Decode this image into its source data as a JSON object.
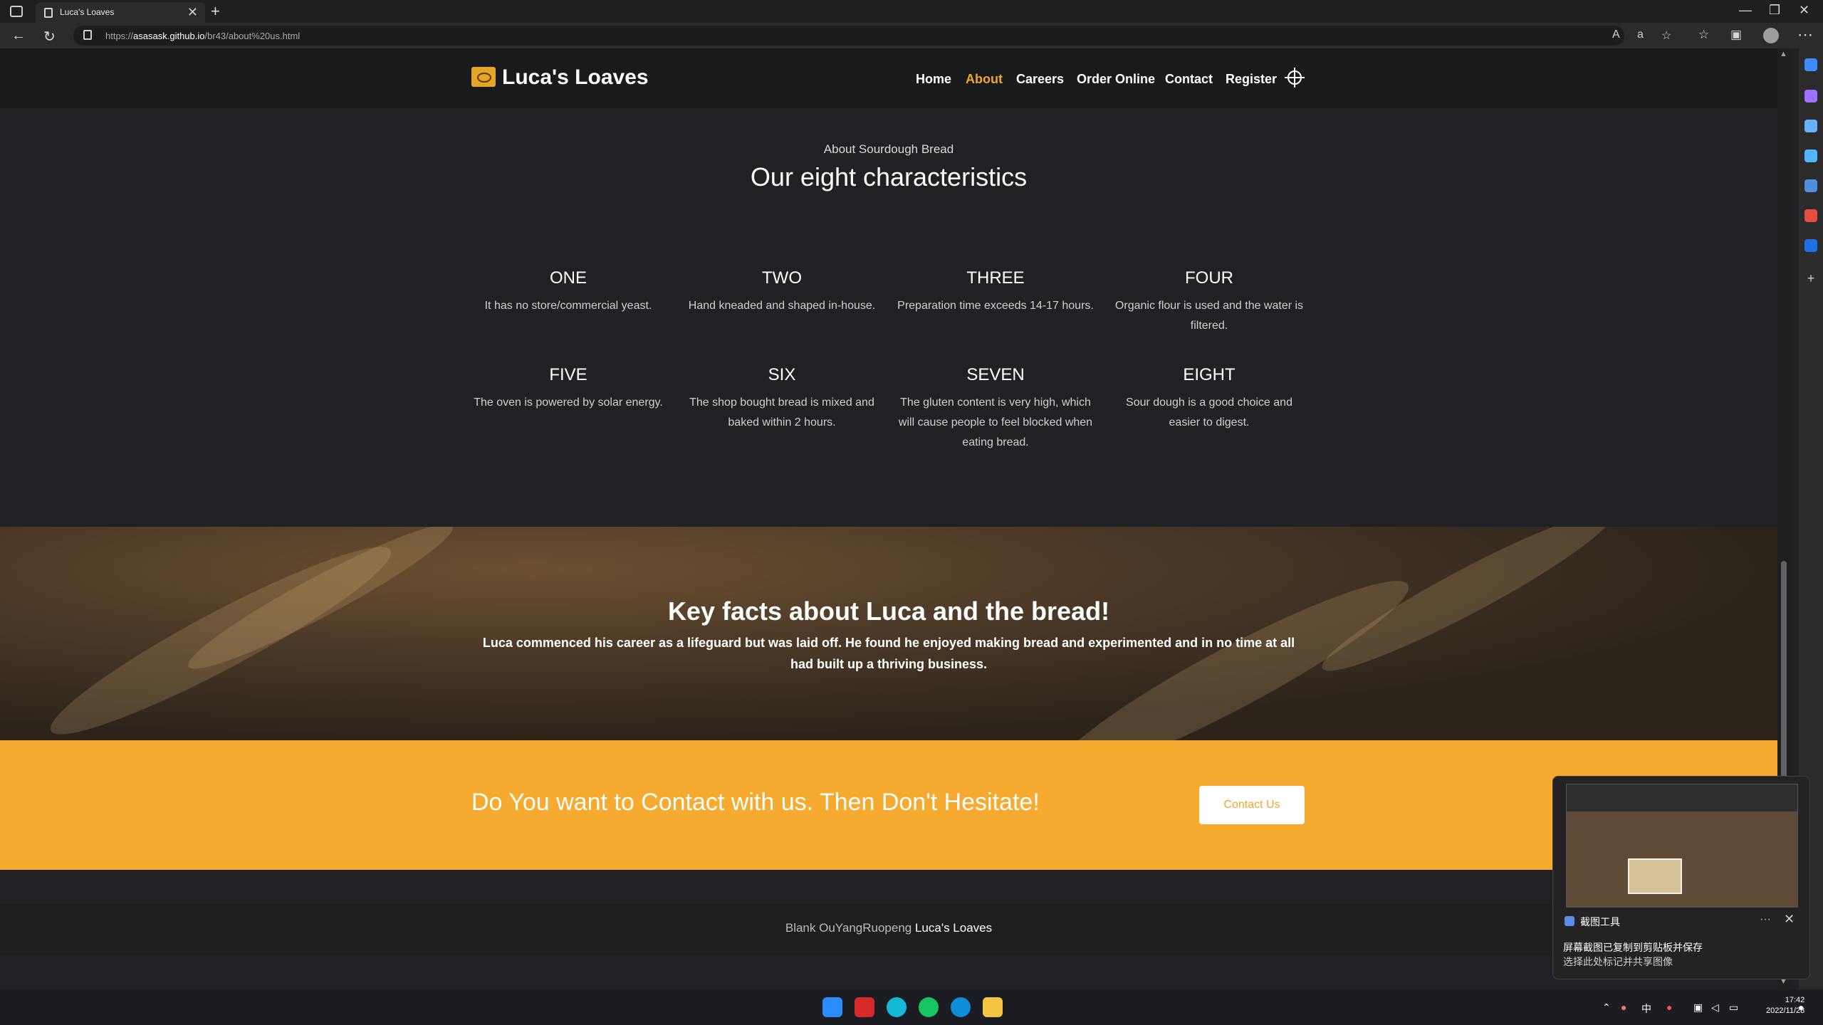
{
  "browser": {
    "tab_title": "Luca's Loaves",
    "new_tab_label": "+",
    "url_prefix": "https://",
    "url_domain": "asasask.github.io",
    "url_path": "/br43/about%20us.html"
  },
  "site": {
    "brand": "Luca's Loaves",
    "nav": [
      {
        "label": "Home",
        "active": false
      },
      {
        "label": "About",
        "active": true
      },
      {
        "label": "Careers",
        "active": false
      },
      {
        "label": "Order Online",
        "active": false
      },
      {
        "label": "Contact",
        "active": false
      },
      {
        "label": "Register",
        "active": false
      }
    ],
    "accent_color": "#f0a72a"
  },
  "about": {
    "eyebrow": "About Sourdough Bread",
    "title": "Our eight characteristics",
    "items": [
      {
        "heading": "ONE",
        "text": "It has no store/commercial yeast."
      },
      {
        "heading": "TWO",
        "text": "Hand kneaded and shaped in-house."
      },
      {
        "heading": "THREE",
        "text": "Preparation time exceeds 14-17 hours."
      },
      {
        "heading": "FOUR",
        "text": "Organic flour is used and the water is filtered."
      },
      {
        "heading": "FIVE",
        "text": "The oven is powered by solar energy."
      },
      {
        "heading": "SIX",
        "text": "The shop bought bread is mixed and baked within 2 hours."
      },
      {
        "heading": "SEVEN",
        "text": "The gluten content is very high, which will cause people to feel blocked when eating bread."
      },
      {
        "heading": "EIGHT",
        "text": "Sour dough is a good choice and easier to digest."
      }
    ]
  },
  "hero": {
    "title": "Key facts about Luca and the bread!",
    "text": "Luca commenced his career as a lifeguard but was laid off. He found he enjoyed making bread and experimented and in no time at all had built up a thriving business."
  },
  "cta": {
    "text": "Do You want to Contact with us. Then Don't Hesitate!",
    "button": "Contact Us"
  },
  "footer": {
    "prefix": "Blank OuYangRuopeng",
    "brand": "Luca's Loaves"
  },
  "toast": {
    "app_name": "截图工具",
    "more": "···",
    "close": "✕",
    "line1": "屏幕截图已复制到剪贴板并保存",
    "line2": "选择此处标记并共享图像"
  },
  "system": {
    "time": "17:42",
    "date": "2022/11/28",
    "ime": "中"
  },
  "icons": {
    "back": "←",
    "reload": "↻",
    "minimize": "—",
    "restore": "❐",
    "close": "✕"
  }
}
